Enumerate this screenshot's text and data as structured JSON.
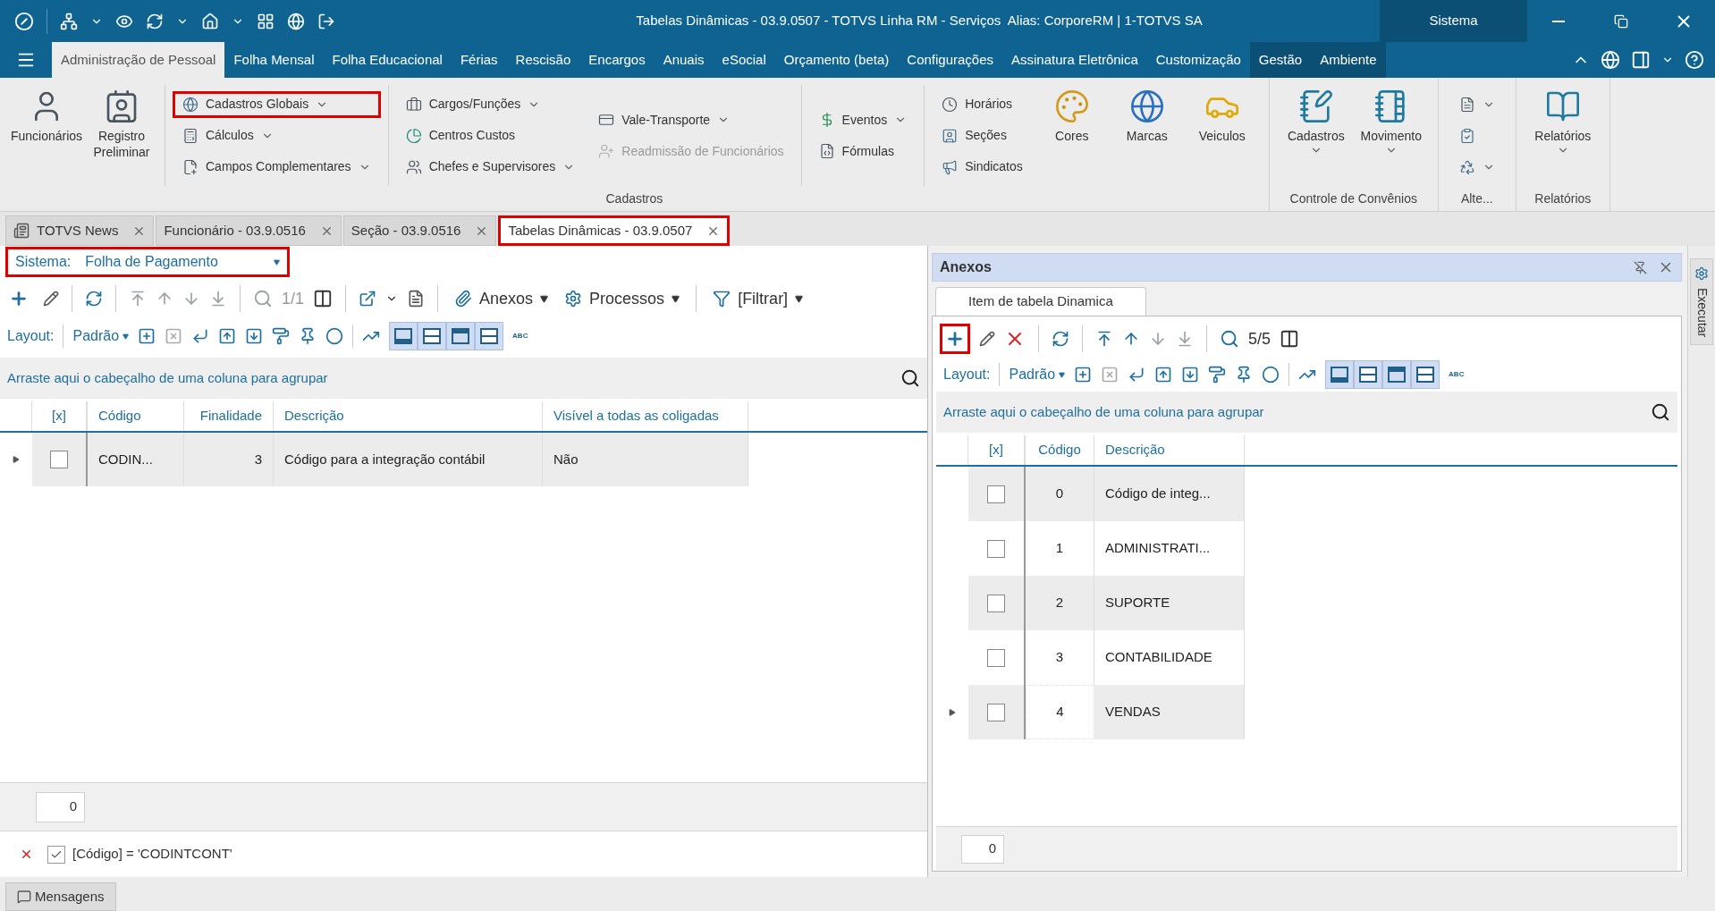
{
  "window": {
    "title": "Tabelas Dinâmicas - 03.9.0507 - TOTVS Linha RM - Serviços  Alias: CorporeRM | 1-TOTVS SA",
    "context": "Sistema"
  },
  "ribbon_tabs": [
    {
      "label": "Administração de Pessoal",
      "selected": true,
      "kind": "main"
    },
    {
      "label": "Folha Mensal",
      "selected": false,
      "kind": "main"
    },
    {
      "label": "Folha Educacional",
      "selected": false,
      "kind": "main"
    },
    {
      "label": "Férias",
      "selected": false,
      "kind": "main"
    },
    {
      "label": "Rescisão",
      "selected": false,
      "kind": "main"
    },
    {
      "label": "Encargos",
      "selected": false,
      "kind": "main"
    },
    {
      "label": "Anuais",
      "selected": false,
      "kind": "main"
    },
    {
      "label": "eSocial",
      "selected": false,
      "kind": "main"
    },
    {
      "label": "Orçamento (beta)",
      "selected": false,
      "kind": "main"
    },
    {
      "label": "Configurações",
      "selected": false,
      "kind": "main"
    },
    {
      "label": "Assinatura Eletrônica",
      "selected": false,
      "kind": "main"
    },
    {
      "label": "Customização",
      "selected": false,
      "kind": "main"
    },
    {
      "label": "Gestão",
      "selected": false,
      "kind": "context"
    },
    {
      "label": "Ambiente",
      "selected": false,
      "kind": "context"
    }
  ],
  "ribbon_groups": [
    {
      "label": "Cadastros",
      "sections": [
        [
          {
            "kind": "large",
            "label": "Funcionários",
            "dropdown": false
          },
          {
            "kind": "large",
            "label": "Registro Preliminar",
            "dropdown": false
          }
        ],
        [
          {
            "kind": "stack",
            "items": [
              {
                "label": "Cadastros Globais",
                "dropdown": true,
                "disabled": false,
                "highlighted": true
              },
              {
                "label": "Cálculos",
                "dropdown": true,
                "disabled": false,
                "highlighted": false
              },
              {
                "label": "Campos Complementares",
                "dropdown": true,
                "disabled": false,
                "highlighted": false
              }
            ]
          }
        ],
        [
          {
            "kind": "stack",
            "items": [
              {
                "label": "Cargos/Funções",
                "dropdown": true,
                "disabled": false,
                "highlighted": false
              },
              {
                "label": "Centros Custos",
                "dropdown": false,
                "disabled": false,
                "highlighted": false
              },
              {
                "label": "Chefes e Supervisores",
                "dropdown": true,
                "disabled": false,
                "highlighted": false
              }
            ]
          },
          {
            "kind": "stack",
            "items": [
              {
                "label": "Vale-Transporte",
                "dropdown": true,
                "disabled": false,
                "highlighted": false
              },
              {
                "label": "Readmissão de Funcionários",
                "dropdown": false,
                "disabled": true,
                "highlighted": false
              }
            ]
          }
        ],
        [
          {
            "kind": "stack",
            "items": [
              {
                "label": "Eventos",
                "dropdown": true,
                "disabled": false,
                "highlighted": false
              },
              {
                "label": "Fórmulas",
                "dropdown": false,
                "disabled": false,
                "highlighted": false
              }
            ]
          }
        ],
        [
          {
            "kind": "stack",
            "items": [
              {
                "label": "Horários",
                "dropdown": false,
                "disabled": false,
                "highlighted": false
              },
              {
                "label": "Seções",
                "dropdown": false,
                "disabled": false,
                "highlighted": false
              },
              {
                "label": "Sindicatos",
                "dropdown": false,
                "disabled": false,
                "highlighted": false
              }
            ]
          },
          {
            "kind": "large",
            "label": "Cores",
            "dropdown": false
          },
          {
            "kind": "large",
            "label": "Marcas",
            "dropdown": false
          },
          {
            "kind": "large",
            "label": "Veiculos",
            "dropdown": false
          }
        ]
      ]
    },
    {
      "label": "Controle de Convênios",
      "sections": [
        [
          {
            "kind": "large",
            "label": "Cadastros",
            "dropdown": true
          },
          {
            "kind": "large",
            "label": "Movimento",
            "dropdown": true
          }
        ]
      ]
    },
    {
      "label": "Alte...",
      "sections": [
        [
          {
            "kind": "stack",
            "items": [
              {
                "dropdown": true,
                "disabled": false,
                "highlighted": false
              },
              {
                "dropdown": false,
                "disabled": false,
                "highlighted": false
              },
              {
                "dropdown": true,
                "disabled": false,
                "highlighted": false
              }
            ]
          }
        ]
      ]
    },
    {
      "label": "Relatórios",
      "sections": [
        [
          {
            "kind": "large",
            "label": "Relatórios",
            "dropdown": true
          }
        ]
      ]
    }
  ],
  "doc_tabs": [
    {
      "label": "TOTVS News",
      "selected": false,
      "highlighted": false,
      "kind": "news"
    },
    {
      "label": "Funcionário - 03.9.0516",
      "selected": false,
      "highlighted": false,
      "kind": "form"
    },
    {
      "label": "Seção - 03.9.0516",
      "selected": false,
      "highlighted": false,
      "kind": "form"
    },
    {
      "label": "Tabelas Dinâmicas - 03.9.0507",
      "selected": true,
      "highlighted": true,
      "kind": "form"
    }
  ],
  "sistema": {
    "label": "Sistema:",
    "value": "Folha de Pagamento",
    "highlighted": true
  },
  "main_toolbar": {
    "kind": "full",
    "page": "1/1",
    "menus": [
      "Anexos",
      "Processos",
      "[Filtrar]"
    ],
    "add_highlighted": false
  },
  "main_layout_bar": {
    "label": "Layout:",
    "preset": "Padrão",
    "views": [
      {
        "selected": true
      },
      {
        "selected": true
      },
      {
        "selected": true
      },
      {
        "selected": true
      }
    ],
    "abc": "ABC"
  },
  "main_grid": {
    "group_hint": "Arraste aqui o cabeçalho de uma coluna para agrupar",
    "checkbox_header": "[x]",
    "columns": [
      "Código",
      "Finalidade",
      "Descrição",
      "Visível a todas as coligadas"
    ],
    "rows": [
      {
        "current": true,
        "checked": false,
        "cells": [
          "CODIN...",
          "3",
          "Código para a integração contábil",
          "Não"
        ]
      }
    ],
    "count": "0"
  },
  "filter": {
    "checked": true,
    "text": "[Código] = 'CODINTCONT'"
  },
  "anexos": {
    "title": "Anexos",
    "tab": "Item de tabela Dinamica",
    "toolbar": {
      "kind": "compact",
      "page": "5/5",
      "add_highlighted": true
    },
    "layout_bar": {
      "label": "Layout:",
      "preset": "Padrão",
      "views": [
        {
          "selected": true
        },
        {
          "selected": true
        },
        {
          "selected": true
        },
        {
          "selected": true
        }
      ],
      "abc": "ABC"
    },
    "grid": {
      "group_hint": "Arraste aqui o cabeçalho de uma coluna para agrupar",
      "checkbox_header": "[x]",
      "columns": [
        "Código",
        "Descrição"
      ],
      "rows": [
        {
          "current": false,
          "checked": false,
          "cells": [
            "0",
            "Código de integ..."
          ]
        },
        {
          "current": false,
          "checked": false,
          "cells": [
            "1",
            "ADMINISTRATI..."
          ]
        },
        {
          "current": false,
          "checked": false,
          "cells": [
            "2",
            "SUPORTE"
          ]
        },
        {
          "current": false,
          "checked": false,
          "cells": [
            "3",
            "CONTABILIDADE"
          ]
        },
        {
          "current": true,
          "checked": false,
          "cells": [
            "4",
            "VENDAS"
          ]
        }
      ],
      "count": "0"
    }
  },
  "side_panel": {
    "label": "Executar"
  },
  "status_bar": {
    "button": "Mensagens"
  }
}
